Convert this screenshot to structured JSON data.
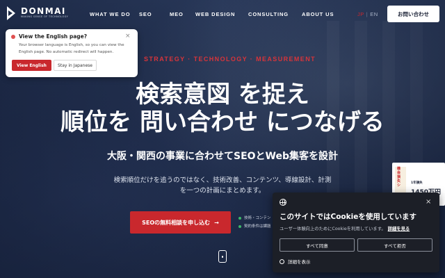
{
  "brand": {
    "name": "DONMAI",
    "tagline": "MAKING SENSE OF TECHNOLOGY"
  },
  "nav": {
    "items": [
      {
        "label": "WHAT WE DO"
      },
      {
        "label": "SEO"
      },
      {
        "label": "MEO"
      },
      {
        "label": "WEB DESIGN"
      },
      {
        "label": "CONSULTING"
      },
      {
        "label": "ABOUT US"
      }
    ],
    "lang_jp": "JP",
    "lang_separator": "|",
    "lang_en": "EN",
    "contact_label": "お問い合わせ"
  },
  "lang_popup": {
    "title": "View the English page?",
    "body": "Your browser language is English, so you can view the English page. No automatic redirect will happen.",
    "primary_label": "View English",
    "secondary_label": "Stay in Japanese",
    "close_symbol": "×"
  },
  "hero": {
    "eyebrow": "STRATEGY · TECHNOLOGY · MEASUREMENT",
    "line1_highlight": "検索意図",
    "line1_rest": " を捉え",
    "line2_pre": "順位を ",
    "line2_highlight": "問い合わせ",
    "line2_rest": " につなげる",
    "subhead": "大阪・関西の事業に合わせてSEOとWeb集客を設計",
    "desc_line1": "検索順位だけを追うのではなく、技術改善、コンテンツ、導線設計、計測",
    "desc_line2": "を一つの計画にまとめます。",
    "cta_label": "SEOの無料相談を申し込む",
    "cta_arrow": "→",
    "bullet1": "技術・コンテン",
    "bullet2": "契約条件は課題"
  },
  "side_card": {
    "vertical_text": "機会損失シ",
    "label": "1年損失",
    "amount": "1450万円"
  },
  "cookie": {
    "close_symbol": "×",
    "title": "このサイトではCookieを使用しています",
    "text": "ユーザー体験向上のためにCookieを利用しています。",
    "link": "詳細を見る",
    "accept_label": "すべて同意",
    "reject_label": "すべて拒否",
    "settings_label": "詳細を表示"
  }
}
